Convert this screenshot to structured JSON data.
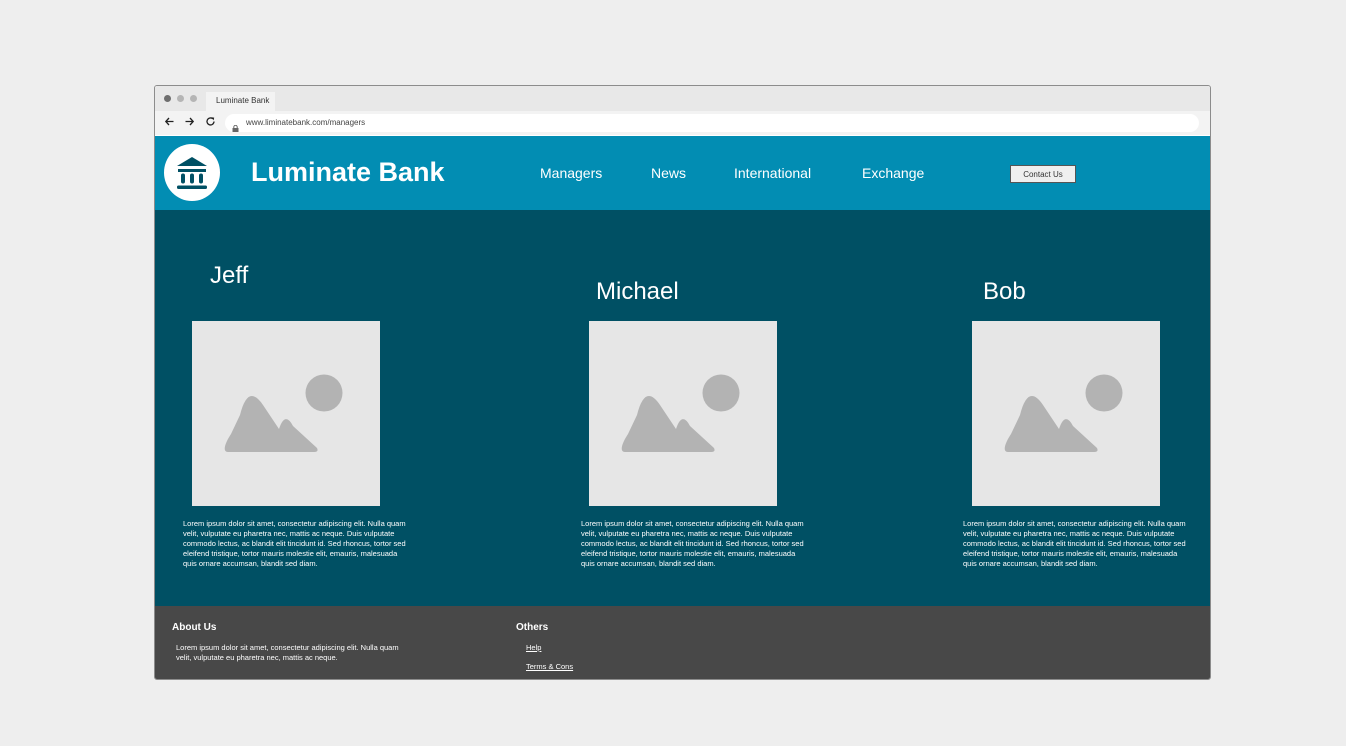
{
  "browser": {
    "tab_title": "Luminate Bank",
    "url": "www.liminatebank.com/managers",
    "back_icon": "arrow-left-icon",
    "forward_icon": "arrow-right-icon",
    "reload_icon": "reload-icon",
    "lock_icon": "lock-icon"
  },
  "header": {
    "logo_icon": "bank-icon",
    "brand": "Luminate Bank",
    "nav": [
      "Managers",
      "News",
      "International",
      "Exchange"
    ],
    "contact_label": "Contact Us"
  },
  "managers": [
    {
      "name": "Jeff",
      "bio": "Lorem ipsum dolor sit amet, consectetur adipiscing elit. Nulla quam velit, vulputate eu pharetra nec, mattis ac neque. Duis vulputate commodo lectus, ac blandit elit tincidunt id. Sed rhoncus, tortor sed eleifend tristique, tortor mauris molestie elit, emauris, malesuada quis ornare accumsan, blandit sed diam."
    },
    {
      "name": "Michael",
      "bio": "Lorem ipsum dolor sit amet, consectetur adipiscing elit. Nulla quam velit, vulputate eu pharetra nec, mattis ac neque. Duis vulputate commodo lectus, ac blandit elit tincidunt id. Sed rhoncus, tortor sed eleifend tristique, tortor mauris molestie elit, emauris, malesuada quis ornare accumsan, blandit sed diam."
    },
    {
      "name": "Bob",
      "bio": "Lorem ipsum dolor sit amet, consectetur adipiscing elit. Nulla quam velit, vulputate eu pharetra nec, mattis ac neque. Duis vulputate commodo lectus, ac blandit elit tincidunt id. Sed rhoncus, tortor sed eleifend tristique, tortor mauris molestie elit, emauris, malesuada quis ornare accumsan, blandit sed diam."
    }
  ],
  "footer": {
    "about_title": "About Us",
    "about_text": "Lorem ipsum dolor sit amet, consectetur adipiscing elit. Nulla quam velit, vulputate eu pharetra nec, mattis ac neque.",
    "others_title": "Others",
    "links": [
      "Help",
      "Terms & Cons"
    ]
  },
  "colors": {
    "header_bg": "#028db3",
    "main_bg": "#005064",
    "footer_bg": "#484848",
    "placeholder_bg": "#e6e6e6",
    "placeholder_fg": "#b3b3b3"
  }
}
